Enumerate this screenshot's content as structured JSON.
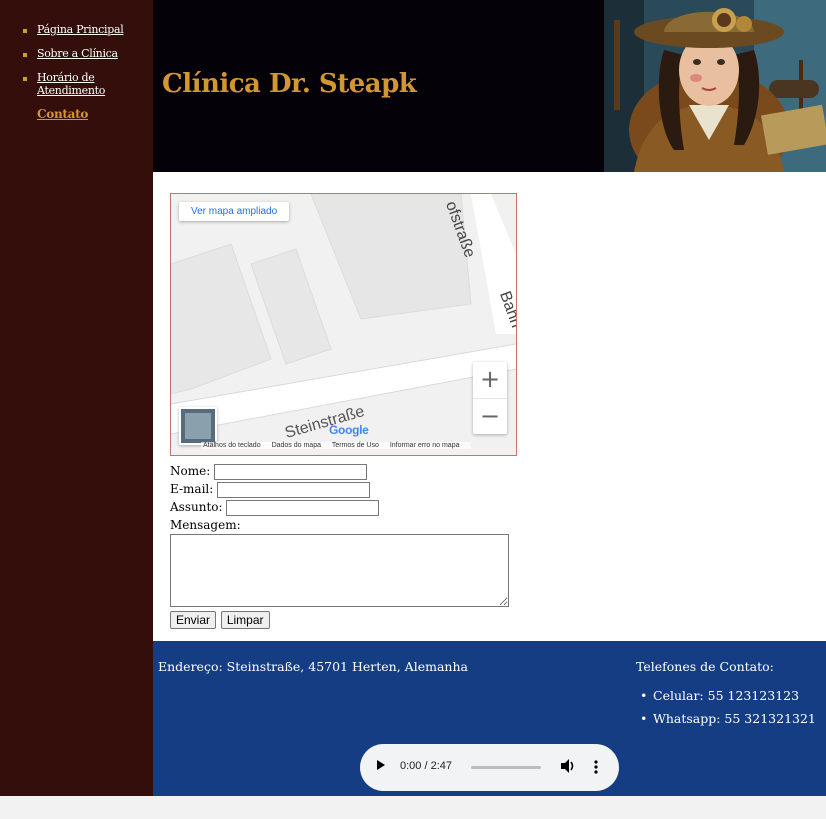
{
  "nav": {
    "items": [
      {
        "label": "Página Principal"
      },
      {
        "label": "Sobre a Clínica"
      },
      {
        "label": "Horário de Atendimento"
      },
      {
        "label": "Contato"
      }
    ]
  },
  "header": {
    "title": "Clínica Dr. Steapk"
  },
  "map": {
    "enlarge_label": "Ver mapa ampliado",
    "street_label": "Steinstraße",
    "road_label_1": "ofstraße",
    "road_label_2": "Bahn",
    "google_label": "Google",
    "zoom_in": "+",
    "zoom_out": "−",
    "attribution": [
      "Atalhos do teclado",
      "Dados do mapa",
      "Termos de Uso",
      "Informar erro no mapa"
    ]
  },
  "form": {
    "nome_label": "Nome:",
    "email_label": "E-mail:",
    "assunto_label": "Assunto:",
    "mensagem_label": "Mensagem:",
    "submit_label": "Enviar",
    "reset_label": "Limpar"
  },
  "footer": {
    "address": "Endereço: Steinstraße, 45701 Herten, Alemanha",
    "phones_title": "Telefones de Contato:",
    "phones": [
      {
        "label": "Celular: 55 123123123"
      },
      {
        "label": "Whatsapp: 55 321321321"
      }
    ]
  },
  "audio": {
    "time": "0:00 / 2:47"
  },
  "colors": {
    "sidebar_bg": "#330e0a",
    "header_bg": "#050108",
    "title_color": "#d29632",
    "footer_bg": "#153d83"
  }
}
